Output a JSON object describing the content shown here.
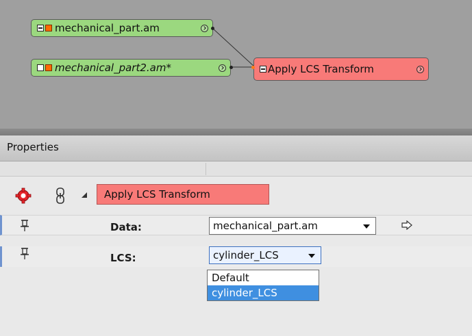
{
  "graph": {
    "nodes": [
      {
        "label": "mechanical_part.am",
        "kind": "data"
      },
      {
        "label": "mechanical_part2.am*",
        "kind": "data"
      },
      {
        "label": "Apply LCS Transform",
        "kind": "compute"
      }
    ]
  },
  "properties": {
    "title": "Properties",
    "module_name": "Apply LCS Transform",
    "rows": [
      {
        "label": "Data:",
        "value": "mechanical_part.am"
      },
      {
        "label": "LCS:",
        "value": "cylinder_LCS"
      }
    ],
    "lcs_options": [
      "Default",
      "cylinder_LCS"
    ],
    "lcs_selected": "cylinder_LCS"
  },
  "colors": {
    "data_node": "#9bd87f",
    "compute_node": "#f87a78",
    "selection": "#3f8fe0",
    "graph_bg": "#9f9f9f",
    "gear": "#e8252a"
  }
}
